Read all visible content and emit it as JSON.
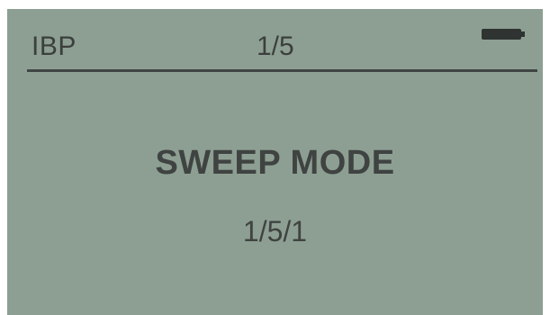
{
  "header": {
    "label": "IBP",
    "page": "1/5",
    "battery_icon": "battery-full-icon"
  },
  "main": {
    "title": "SWEEP MODE",
    "value": "1/5/1"
  },
  "colors": {
    "screen_background": "#8d9f93",
    "text": "#3f4341",
    "divider": "#404543"
  }
}
